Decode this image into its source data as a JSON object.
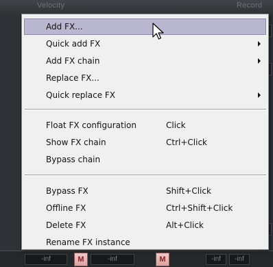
{
  "background": {
    "header_left_text": "Velocity",
    "header_right_text": "Record",
    "meter_labels": [
      "-inf",
      "-inf",
      "-inf",
      "-inf"
    ],
    "mute_label": "M"
  },
  "context_menu": {
    "items": [
      {
        "label": "Add FX...",
        "shortcut": "",
        "has_submenu": false,
        "highlighted": true
      },
      {
        "label": "Quick add FX",
        "shortcut": "",
        "has_submenu": true,
        "highlighted": false
      },
      {
        "label": "Add FX chain",
        "shortcut": "",
        "has_submenu": true,
        "highlighted": false
      },
      {
        "label": "Replace FX...",
        "shortcut": "",
        "has_submenu": false,
        "highlighted": false
      },
      {
        "label": "Quick replace FX",
        "shortcut": "",
        "has_submenu": true,
        "highlighted": false
      },
      {
        "label": "Float FX configuration",
        "shortcut": "Click",
        "has_submenu": false,
        "highlighted": false
      },
      {
        "label": "Show FX chain",
        "shortcut": "Ctrl+Click",
        "has_submenu": false,
        "highlighted": false
      },
      {
        "label": "Bypass chain",
        "shortcut": "",
        "has_submenu": false,
        "highlighted": false
      },
      {
        "label": "Bypass FX",
        "shortcut": "Shift+Click",
        "has_submenu": false,
        "highlighted": false
      },
      {
        "label": "Offline FX",
        "shortcut": "Ctrl+Shift+Click",
        "has_submenu": false,
        "highlighted": false
      },
      {
        "label": "Delete FX",
        "shortcut": "Alt+Click",
        "has_submenu": false,
        "highlighted": false
      },
      {
        "label": "Rename FX instance",
        "shortcut": "",
        "has_submenu": false,
        "highlighted": false
      }
    ]
  },
  "colors": {
    "menu_background": "#f0f0f0",
    "highlight_background": "#b9b7cf",
    "highlight_border": "#8c88b2",
    "app_background": "#3a3e42"
  }
}
